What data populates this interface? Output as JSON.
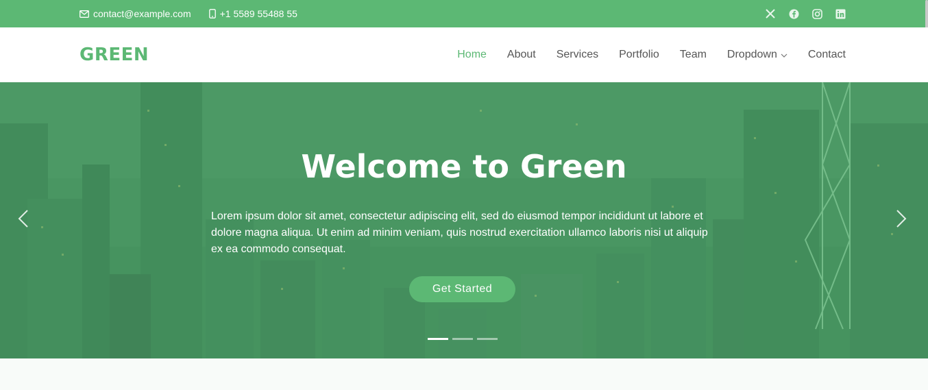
{
  "colors": {
    "brand": "#5cb874",
    "nav_text": "#555555",
    "white": "#ffffff"
  },
  "topbar": {
    "email": "contact@example.com",
    "email_icon": "envelope-icon",
    "phone": "+1 5589 55488 55",
    "phone_icon": "phone-icon",
    "socials": [
      "x-icon",
      "facebook-icon",
      "instagram-icon",
      "linkedin-icon"
    ]
  },
  "header": {
    "logo": "GREEN",
    "nav": {
      "home": "Home",
      "about": "About",
      "services": "Services",
      "portfolio": "Portfolio",
      "team": "Team",
      "dropdown": "Dropdown",
      "contact": "Contact"
    },
    "active": "Home"
  },
  "hero": {
    "title": "Welcome to Green",
    "text": "Lorem ipsum dolor sit amet, consectetur adipiscing elit, sed do eiusmod tempor incididunt ut labore et dolore magna aliqua. Ut enim ad minim veniam, quis nostrud exercitation ullamco laboris nisi ut aliquip ex ea commodo consequat.",
    "cta": "Get Started",
    "slides_count": 3,
    "active_slide": 1
  }
}
